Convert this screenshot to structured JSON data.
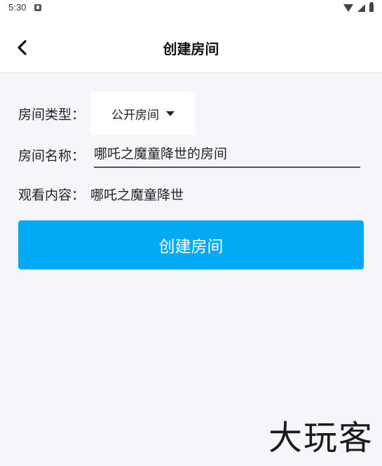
{
  "status_bar": {
    "time": "5:30",
    "notification_icon": "notification-icon",
    "wifi_icon": "wifi-icon",
    "signal_icon": "signal-icon",
    "battery_icon": "battery-icon"
  },
  "app_bar": {
    "back_icon": "chevron-left-icon",
    "title": "创建房间"
  },
  "form": {
    "room_type_label": "房间类型：",
    "room_type_value": "公开房间",
    "room_name_label": "房间名称：",
    "room_name_value": "哪吒之魔童降世的房间",
    "watch_label": "观看内容：",
    "watch_value": "哪吒之魔童降世"
  },
  "actions": {
    "create_label": "创建房间",
    "accent_color": "#03a9f4"
  },
  "watermark": {
    "text": "大玩客"
  }
}
